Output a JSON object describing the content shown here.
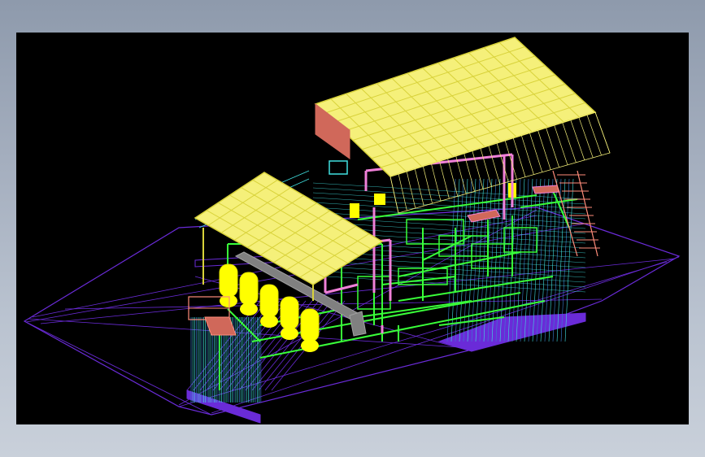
{
  "app": {
    "background_color": "#a4aebe",
    "viewport_color": "#000000"
  },
  "model": {
    "layer_colors": {
      "roof": "#f5f07a",
      "roof_edge": "#d8d23a",
      "frame": "#39ff39",
      "pipe": "#f080d8",
      "base": "#6a2bd8",
      "detail": "#40e0e0",
      "stair": "#ff8c7a",
      "tank": "#ffff00",
      "steel": "#808080",
      "wall": "#d0685a"
    }
  }
}
